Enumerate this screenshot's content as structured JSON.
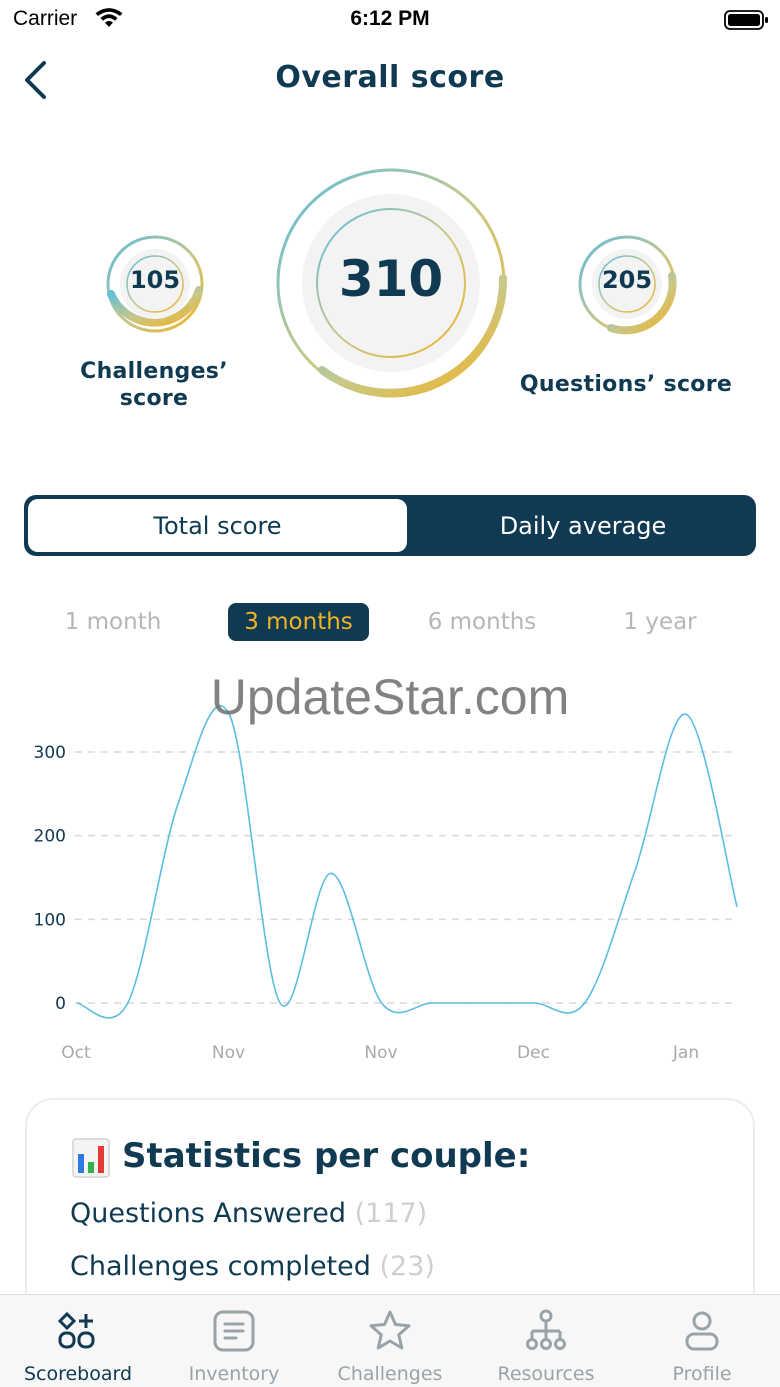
{
  "status": {
    "carrier": "Carrier",
    "time": "6:12 PM"
  },
  "nav": {
    "title": "Overall score",
    "back_icon": "chevron-left-icon"
  },
  "scores": {
    "overall": {
      "value": "310"
    },
    "challenges": {
      "value": "105",
      "label": "Challenges’ score"
    },
    "questions": {
      "value": "205",
      "label": "Questions’ score"
    }
  },
  "toggle": {
    "total_label": "Total score",
    "daily_label": "Daily average",
    "selected": "Total score"
  },
  "ranges": {
    "items": [
      "1 month",
      "3 months",
      "6 months",
      "1 year"
    ],
    "selected": "3 months"
  },
  "watermark": "UpdateStar.com",
  "chart_data": {
    "type": "line",
    "x": [
      0,
      1,
      2,
      3,
      4,
      5,
      6,
      7,
      8,
      9,
      10,
      11,
      12,
      13
    ],
    "x_tick_labels": [
      "Oct",
      "Nov",
      "Nov",
      "Dec",
      "Jan"
    ],
    "series": [
      {
        "values": [
          0,
          0,
          240,
          345,
          0,
          155,
          0,
          0,
          0,
          0,
          0,
          160,
          345,
          115
        ]
      }
    ],
    "y_ticks": [
      0,
      100,
      200,
      300
    ],
    "ylim": [
      0,
      345
    ],
    "grid": true,
    "line_color": "#5bbde0"
  },
  "stats": {
    "title": "Statistics per couple:",
    "icon": "bar-chart-icon",
    "rows": [
      {
        "label": "Questions Answered",
        "count": "(117)"
      },
      {
        "label": "Challenges completed",
        "count": "(23)"
      }
    ]
  },
  "tabs": [
    {
      "label": "Scoreboard",
      "icon": "scoreboard-icon"
    },
    {
      "label": "Inventory",
      "icon": "inventory-icon"
    },
    {
      "label": "Challenges",
      "icon": "star-icon"
    },
    {
      "label": "Resources",
      "icon": "hierarchy-icon"
    },
    {
      "label": "Profile",
      "icon": "profile-icon"
    }
  ],
  "colors": {
    "primary": "#0f3a52",
    "accent": "#f0b323",
    "ring_blue": "#5bbde0"
  }
}
